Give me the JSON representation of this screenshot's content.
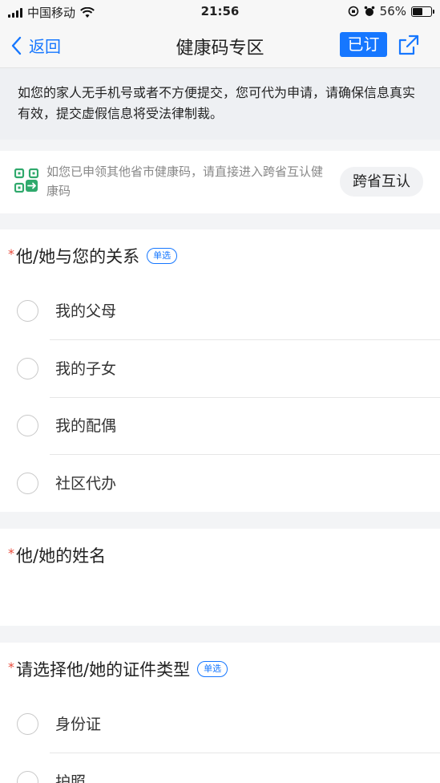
{
  "status_bar": {
    "carrier": "中国移动",
    "time": "21:56",
    "battery": "56%",
    "battery_level": 0.56
  },
  "nav": {
    "back_label": "返回",
    "title": "健康码专区",
    "subscribed_label": "已订",
    "share_icon": "share-icon"
  },
  "notice": {
    "text": "如您的家人无手机号或者不方便提交，您可代为申请，请确保信息真实有效，提交虚假信息将受法律制裁。"
  },
  "cross_province": {
    "text": "如您已申领其他省市健康码，请直接进入跨省互认健康码",
    "button_label": "跨省互认"
  },
  "questions": {
    "relation": {
      "required_mark": "*",
      "title": "他/她与您的关系",
      "badge": "单选",
      "options": [
        "我的父母",
        "我的子女",
        "我的配偶",
        "社区代办"
      ]
    },
    "name": {
      "required_mark": "*",
      "title": "他/她的姓名"
    },
    "id_type": {
      "required_mark": "*",
      "title": "请选择他/她的证件类型",
      "badge": "单选",
      "options": [
        "身份证",
        "护照"
      ]
    }
  },
  "colors": {
    "accent": "#1677ff",
    "required": "#e84a3a",
    "background": "#f3f4f6"
  }
}
